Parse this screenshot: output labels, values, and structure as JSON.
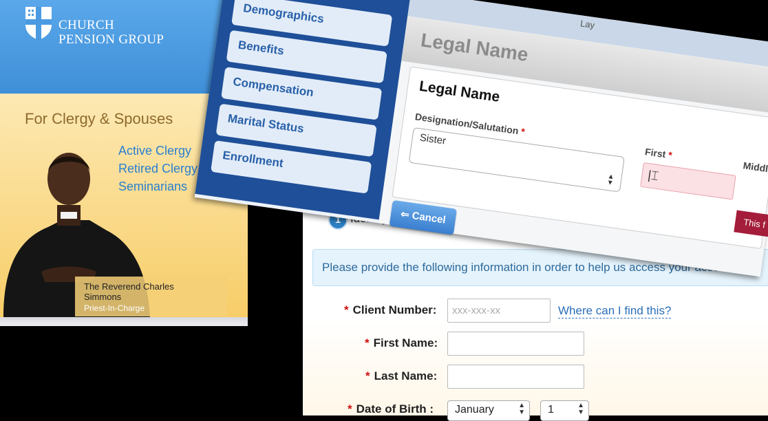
{
  "cpg": {
    "logo_line1": "CHURCH",
    "logo_line2": "PENSION GROUP",
    "section_title": "For Clergy & Spouses",
    "links": [
      "Active Clergy",
      "Retired Clergy",
      "Seminarians"
    ],
    "caption_name": "The Reverend Charles Simmons",
    "caption_role": "Priest-In-Charge",
    "colors": {
      "header": "#4a9be2",
      "body": "#f7cd68",
      "link": "#2a7fd0"
    }
  },
  "form": {
    "step_number": "1",
    "step_label": "Identify",
    "info_text": "Please provide the following information in order to help us access your account.",
    "fields": {
      "client_number_label": "Client Number:",
      "client_number_placeholder": "xxx-xxx-xx",
      "help_link": "Where can I find this?",
      "first_name_label": "First Name:",
      "last_name_label": "Last Name:",
      "dob_label": "Date of Birth :",
      "dob_month": "January",
      "dob_day": "1"
    },
    "required_marker": "*"
  },
  "overlay": {
    "nav_tabs": [
      "Demographics",
      "Benefits",
      "Compensation",
      "Marital Status",
      "Enrollment"
    ],
    "topbar_label": "Lay",
    "window_title": "Legal Name",
    "card_heading": "Legal Name",
    "designation_label": "Designation/Salutation",
    "designation_value": "Sister",
    "first_label": "First",
    "middle_label": "Middle",
    "error_text": "This f",
    "cancel_label": "Cancel"
  }
}
